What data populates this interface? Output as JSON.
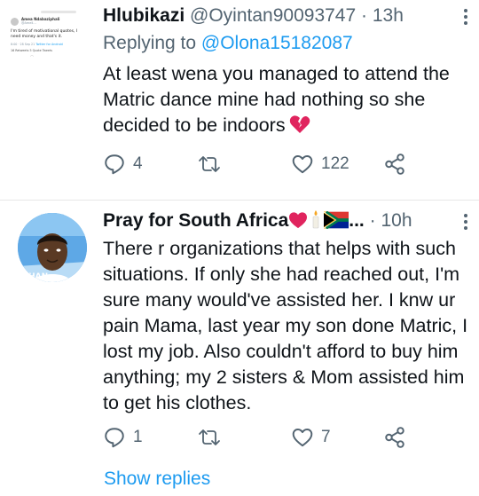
{
  "tweet1": {
    "name": "Hlubikazi",
    "handle": "@Oyintan90093747",
    "dot": "·",
    "time": "13h",
    "replying_prefix": "Replying to",
    "replying_to": "@Olona15182087",
    "text": "At least wena you managed to attend the Matric dance mine had nothing so she decided to be indoors",
    "emoji": "broken-heart",
    "reply_count": "4",
    "retweet_count": "",
    "like_count": "122",
    "embedded_card": {
      "name": "Amea Ndabaziphali",
      "handle": "@Amell...",
      "text": "I'm tired of motivational quotes, I need money and that's it.",
      "time": "8:00 · 28 Sep 21",
      "source": "Twitter for Android",
      "stats": "16 Retweets  5 Quote Tweets"
    }
  },
  "tweet2": {
    "name": "Pray for South Africa",
    "name_emojis": "❤ 🕯 🇿🇦...",
    "dot": "·",
    "time": "10h",
    "text": "There r organizations that helps with such situations. If only she had reached out, I'm sure many would've assisted her. I knw ur pain Mama, last year my son done Matric, I lost my job. Also couldn't afford to buy him anything; my 2 sisters & Mom assisted him to get his clothes.",
    "reply_count": "1",
    "retweet_count": "",
    "like_count": "7",
    "show_replies": "Show replies"
  },
  "icons": {
    "reply": "reply-icon",
    "retweet": "retweet-icon",
    "like": "heart-icon",
    "share": "share-icon",
    "more": "more-icon"
  },
  "colors": {
    "accent": "#1d9bf0",
    "secondary_text": "#536471",
    "primary_text": "#0f1419",
    "heart_red": "#e0245e"
  }
}
